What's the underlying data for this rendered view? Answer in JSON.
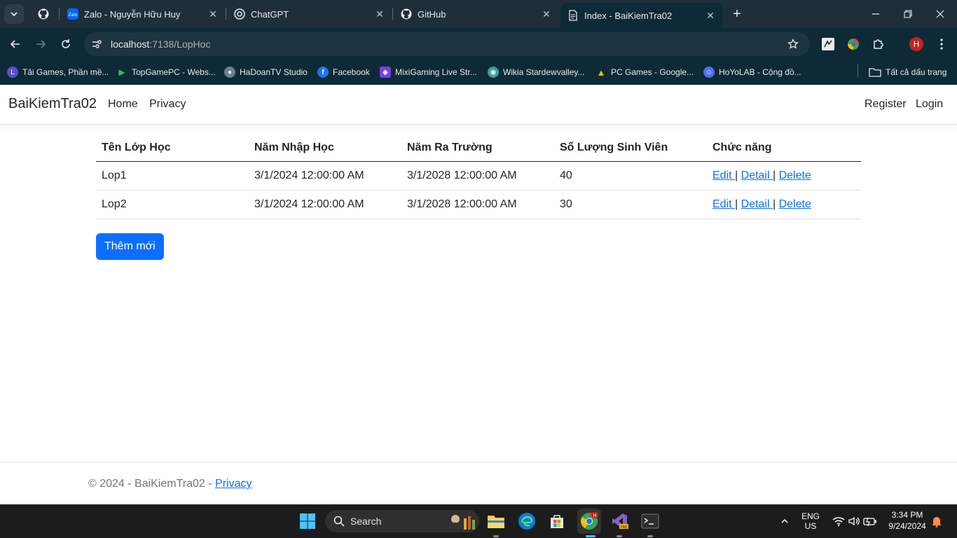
{
  "browser": {
    "tabs": [
      {
        "title": "",
        "icon": "github-icon"
      },
      {
        "title": "Zalo - Nguyễn Hữu Huy",
        "icon": "zalo-icon"
      },
      {
        "title": "ChatGPT",
        "icon": "chatgpt-icon"
      },
      {
        "title": "GitHub",
        "icon": "github-icon"
      },
      {
        "title": "Index - BaiKiemTra02",
        "icon": "page-icon",
        "active": true
      }
    ],
    "url_host": "localhost",
    "url_rest": ":7138/LopHoc",
    "profile_initial": "H",
    "bookmarks": [
      {
        "label": "Tải Games, Phần mề...",
        "color": "#5a4fcf",
        "glyph": "L"
      },
      {
        "label": "TopGamePC - Webs...",
        "color": "#1f9d3a",
        "glyph": "▶"
      },
      {
        "label": "HaDoanTV Studio",
        "color": "#6b7f8c",
        "glyph": "●"
      },
      {
        "label": "Facebook",
        "color": "#1877f2",
        "glyph": "f"
      },
      {
        "label": "MixiGaming Live Str...",
        "color": "#7b3fe4",
        "glyph": "◆"
      },
      {
        "label": "Wikia Stardewvalley...",
        "color": "#3b9e9e",
        "glyph": "◉"
      },
      {
        "label": "PC Games - Google...",
        "color": "#1a73e8",
        "glyph": "▲"
      },
      {
        "label": "HoYoLAB - Cộng đồ...",
        "color": "#4e6ef2",
        "glyph": "☺"
      }
    ],
    "all_bookmarks": "Tất cả dấu trang"
  },
  "nav": {
    "brand": "BaiKiemTra02",
    "links": [
      "Home",
      "Privacy"
    ],
    "right": [
      "Register",
      "Login"
    ]
  },
  "table": {
    "headers": [
      "Tên Lớp Học",
      "Năm Nhập Học",
      "Năm Ra Trường",
      "Số Lượng Sinh Viên",
      "Chức năng"
    ],
    "rows": [
      {
        "ten": "Lop1",
        "nhap": "3/1/2024 12:00:00 AM",
        "ra": "3/1/2028 12:00:00 AM",
        "sl": "40"
      },
      {
        "ten": "Lop2",
        "nhap": "3/1/2024 12:00:00 AM",
        "ra": "3/1/2028 12:00:00 AM",
        "sl": "30"
      }
    ],
    "actions": {
      "edit": "Edit ",
      "detail": "Detail ",
      "delete": "Delete",
      "sep": "|"
    }
  },
  "add_button": "Thêm mới",
  "footer": {
    "text": "© 2024 - BaiKiemTra02 - ",
    "link": "Privacy"
  },
  "taskbar": {
    "search": "Search",
    "lang": "ENG",
    "region": "US",
    "time": "3:34 PM",
    "date": "9/24/2024"
  }
}
